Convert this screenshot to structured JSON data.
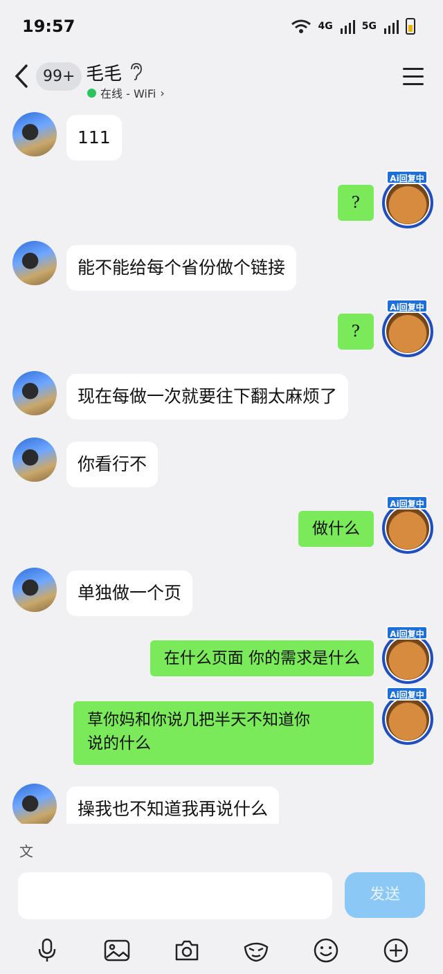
{
  "status_bar": {
    "time": "19:57",
    "net1": "4G",
    "net2": "5G"
  },
  "header": {
    "unread": "99+",
    "title": "毛毛",
    "presence": "在线 - WiFi",
    "presence_arrow": "›"
  },
  "ai_badge": "Ai回复中",
  "messages": [
    {
      "side": "left",
      "text": "111"
    },
    {
      "side": "right",
      "text": "?"
    },
    {
      "side": "left",
      "text": "能不能给每个省份做个链接"
    },
    {
      "side": "right",
      "text": "?"
    },
    {
      "side": "left",
      "text": "现在每做一次就要往下翻太麻烦了"
    },
    {
      "side": "left",
      "text": "你看行不"
    },
    {
      "side": "right",
      "text": "做什么"
    },
    {
      "side": "left",
      "text": "单独做一个页"
    },
    {
      "side": "right",
      "text": "在什么页面 你的需求是什么"
    },
    {
      "side": "right",
      "text": "草你妈和你说几把半天不知道你",
      "text2": "说的什么"
    },
    {
      "side": "left",
      "text": "操我也不知道我再说什么"
    }
  ],
  "input": {
    "translate_label": "文",
    "placeholder": "",
    "send_label": "发送"
  },
  "colors": {
    "bg": "#f1f1f4",
    "left_bubble": "#ffffff",
    "right_bubble": "#7ae95a",
    "send": "#8cc8f6",
    "online": "#2ac560"
  },
  "icons": [
    "back-icon",
    "ear-icon",
    "menu-icon",
    "mic-icon",
    "image-icon",
    "camera-icon",
    "sticker-icon",
    "emoji-icon",
    "plus-icon"
  ]
}
